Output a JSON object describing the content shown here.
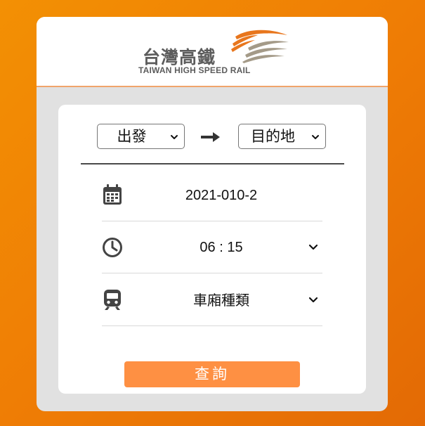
{
  "brand": {
    "name_zh": "台灣高鐵",
    "name_en": "TAIWAN HIGH SPEED RAIL",
    "colors": {
      "accent": "#fe9043",
      "background_orange": "#ef7d05",
      "logo_gray": "#5c5c5c",
      "logo_orange": "#e8761d"
    }
  },
  "route": {
    "origin": {
      "selected": "出發",
      "icon": "chevron-down-icon"
    },
    "arrow_icon": "arrow-right-icon",
    "destination": {
      "selected": "目的地",
      "icon": "chevron-down-icon"
    }
  },
  "fields": {
    "date": {
      "icon": "calendar-icon",
      "value": "2021-010-2"
    },
    "time": {
      "icon": "clock-icon",
      "value": "06 : 15",
      "dropdown_icon": "chevron-down-icon"
    },
    "car_type": {
      "icon": "train-icon",
      "value": "車廂種類",
      "dropdown_icon": "chevron-down-icon"
    }
  },
  "actions": {
    "search_label": "查詢"
  }
}
